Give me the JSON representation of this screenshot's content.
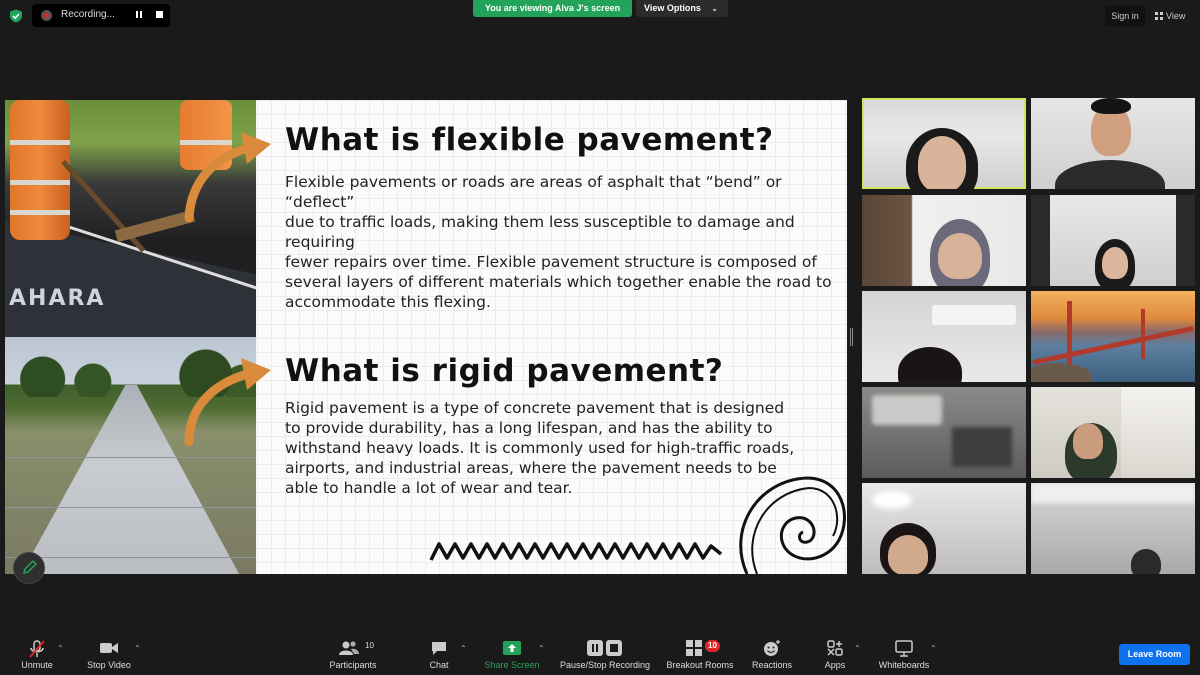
{
  "top_bar": {
    "recording_label": "Recording...",
    "viewing_banner": "You are viewing Alva J's screen",
    "view_options_label": "View Options",
    "sign_in_label": "Sign in",
    "view_label": "View"
  },
  "slide": {
    "brand_text": "AHARA",
    "section1_title": "What is flexible pavement?",
    "section1_lines": [
      "Flexible pavements or roads are areas of asphalt that “bend” or “deflect”",
      "due to traffic loads, making them less susceptible to damage and requiring",
      "fewer repairs over time.  Flexible pavement structure is composed of",
      "several layers of different materials which together enable the road to",
      "accommodate this flexing."
    ],
    "section2_title": "What is rigid pavement?",
    "section2_lines": [
      "Rigid pavement is a type of concrete pavement that is designed",
      "to provide durability, has a long lifespan, and has the ability to",
      "withstand heavy loads. It is commonly used for high-traffic roads,",
      "airports, and industrial areas, where the pavement needs to be",
      "able to handle a lot of wear and tear."
    ],
    "accent_color": "#d98a3a"
  },
  "toolbar": {
    "unmute_label": "Unmute",
    "stop_video_label": "Stop Video",
    "participants_label": "Participants",
    "participants_count": "10",
    "chat_label": "Chat",
    "share_screen_label": "Share Screen",
    "recording_label": "Pause/Stop Recording",
    "breakout_label": "Breakout Rooms",
    "breakout_badge": "10",
    "reactions_label": "Reactions",
    "apps_label": "Apps",
    "whiteboards_label": "Whiteboards",
    "leave_label": "Leave Room"
  },
  "colors": {
    "banner_green": "#23a35a",
    "leave_blue": "#0e72ed",
    "active_speaker_border": "#c9e85a",
    "mute_red": "#e02828"
  }
}
